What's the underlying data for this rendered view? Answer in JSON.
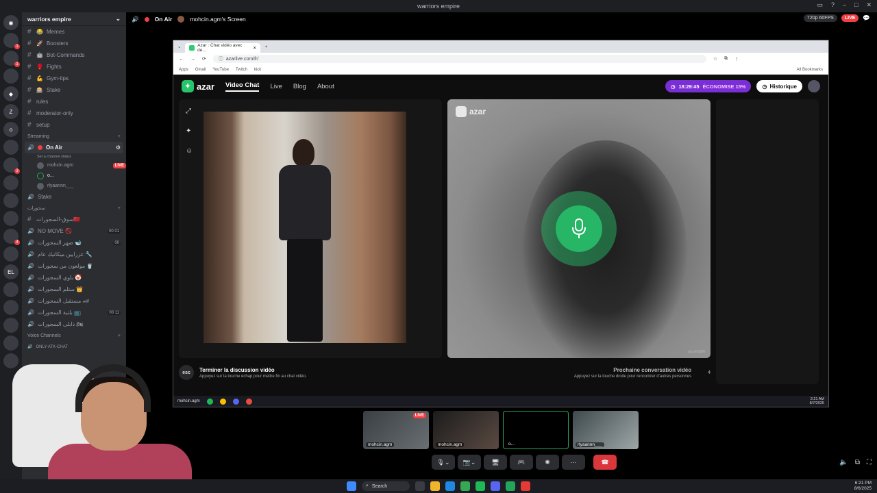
{
  "window": {
    "title": "warriors empire"
  },
  "top_right": {
    "quality": "720p 60FPS",
    "live": "LIVE"
  },
  "server": {
    "name": "warriors empire"
  },
  "channels": [
    {
      "name": "Memes",
      "emoji": "😂"
    },
    {
      "name": "Boosters",
      "emoji": "🚀"
    },
    {
      "name": "Bot-Commands",
      "emoji": "🤖"
    },
    {
      "name": "Fights",
      "emoji": "🥊"
    },
    {
      "name": "Gym-tips",
      "emoji": "💪"
    },
    {
      "name": "Stake",
      "emoji": "🎰"
    },
    {
      "name": "rules",
      "emoji": ""
    },
    {
      "name": "moderator-only",
      "emoji": ""
    },
    {
      "name": "setup",
      "emoji": ""
    }
  ],
  "streaming": {
    "category": "Streaming",
    "channel": "On Air",
    "status_hint": "Set a channel status",
    "members": [
      {
        "name": "mohcin.agm",
        "badge": "LIVE"
      },
      {
        "name": "o...",
        "badge": ""
      },
      {
        "name": "rlyaannn___",
        "badge": ""
      }
    ],
    "stake": "Stake"
  },
  "arabic_category": "سجورات",
  "arabic_channels": [
    {
      "name": "سوق-السجورات🇲🇦",
      "count": ""
    },
    {
      "name": "NO MOVE 🚫",
      "count": "00 01"
    },
    {
      "name": "ضهر السجورات 🐋",
      "count": "00"
    },
    {
      "name": "عزرايين ميكانيك عام 🔧",
      "count": ""
    },
    {
      "name": "مولعون من سجورات 🥤",
      "count": ""
    },
    {
      "name": "بلوي السجورات 🤡",
      "count": ""
    },
    {
      "name": "ستلم السجورات 👑",
      "count": ""
    },
    {
      "name": "مستقبل السجورات 🏎",
      "count": ""
    },
    {
      "name": "بلتية السجورات 📺",
      "count": "00 11"
    },
    {
      "name": "ذابلى السجورات 🏍",
      "count": ""
    }
  ],
  "voice_category": "Voice Channels",
  "voice_first": "ONLY-ATK-CHAT",
  "stage": {
    "channel": "On Air",
    "screen_title": "mohcin.agm's Screen"
  },
  "browser": {
    "tab_title": "Azar : Chat vidéo avec de...",
    "url": "azarlive.com/fr/",
    "bookmarks": [
      "Apps",
      "Gmail",
      "YouTube",
      "Twitch",
      "kick"
    ],
    "all_bookmarks": "All Bookmarks"
  },
  "azar": {
    "logo": "azar",
    "nav": [
      "Video Chat",
      "Live",
      "Blog",
      "About"
    ],
    "promo_time": "18:29:45",
    "promo_text": "ÉCONOMISE 15%",
    "history": "Historique",
    "footer_left_title": "Terminer la discussion vidéo",
    "footer_left_sub": "Appuyez sur la touche échap pour mettre fin au chat vidéo.",
    "esc": "esc",
    "footer_right_title": "Prochaine conversation vidéo",
    "footer_right_sub": "Appuyez sur la touche droite pour rencontrer d'autres personnes",
    "footer_right_num": "4",
    "watermark": "azr jnr3u06"
  },
  "inner_taskbar": {
    "user": "mohcin.agm",
    "time": "2:21 AM",
    "date": "8/7/2025"
  },
  "tiles": [
    {
      "name": "mohcin.agm",
      "badge": "LIVE"
    },
    {
      "name": "mohcin.agm",
      "badge": ""
    },
    {
      "name": "o...",
      "badge": ""
    },
    {
      "name": "rlyaannn___",
      "badge": ""
    }
  ],
  "taskbar": {
    "search": "Search",
    "time": "6:21 PM",
    "date": "8/6/2025"
  },
  "colors": {
    "discord_bg": "#1e1f22",
    "sidebar": "#2b2d31",
    "live_red": "#f23f43",
    "azar_green": "#27c46b",
    "promo_purple": "#7a2fd6"
  }
}
